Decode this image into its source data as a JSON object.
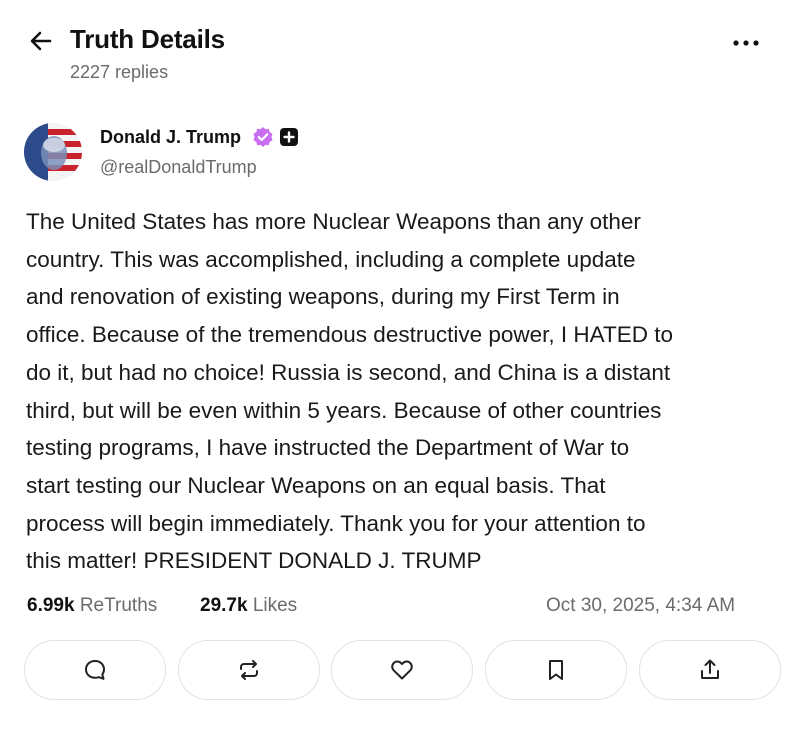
{
  "header": {
    "title": "Truth Details",
    "replies": "2227 replies",
    "back_icon": "arrow-left-icon",
    "more_icon": "more-horizontal-icon"
  },
  "author": {
    "name": "Donald J. Trump",
    "handle": "@realDonaldTrump",
    "verified_icon": "verified-badge-icon",
    "verified_color": "#c86df0",
    "plus_icon": "plus-badge-icon"
  },
  "post": {
    "text": "The United States has more Nuclear Weapons than any other\ncountry. This was accomplished, including a complete update\nand renovation of existing weapons, during my First Term in\noffice. Because of the tremendous destructive power, I HATED to\ndo it, but had no choice! Russia is second, and China is a distant\nthird, but will be even within 5 years. Because of other countries\ntesting programs, I have instructed the Department of War to\nstart testing our Nuclear Weapons on an equal basis. That\nprocess will begin immediately. Thank you for your attention to\nthis matter! PRESIDENT DONALD J. TRUMP"
  },
  "stats": {
    "retruths_count": "6.99k",
    "retruths_label": "ReTruths",
    "likes_count": "29.7k",
    "likes_label": "Likes",
    "timestamp": "Oct 30, 2025, 4:34 AM"
  },
  "actions": [
    {
      "icon": "reply-icon"
    },
    {
      "icon": "retruth-icon"
    },
    {
      "icon": "heart-icon"
    },
    {
      "icon": "bookmark-icon"
    },
    {
      "icon": "share-icon"
    }
  ],
  "colors": {
    "text": "#111111",
    "muted": "#6b6b6b",
    "border": "#e2e2e2"
  }
}
